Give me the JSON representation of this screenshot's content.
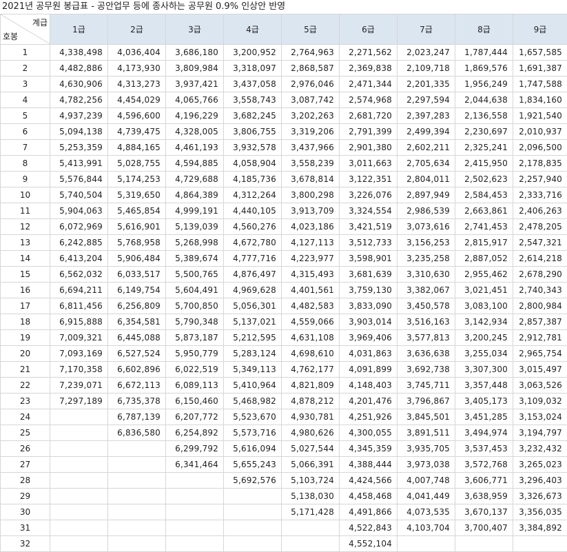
{
  "title": "2021년 공무원 봉급표 - 공안업무 등에 종사하는 공무원 0.9% 인상안 반영",
  "corner": {
    "grade_label": "계급",
    "step_label": "호봉"
  },
  "grades": [
    "1급",
    "2급",
    "3급",
    "4급",
    "5급",
    "6급",
    "7급",
    "8급",
    "9급"
  ],
  "rows": [
    {
      "step": "1",
      "values": [
        "4,338,498",
        "4,036,404",
        "3,686,180",
        "3,200,952",
        "2,764,963",
        "2,271,562",
        "2,023,247",
        "1,787,444",
        "1,657,585"
      ]
    },
    {
      "step": "2",
      "values": [
        "4,482,886",
        "4,173,930",
        "3,809,984",
        "3,318,097",
        "2,868,587",
        "2,369,838",
        "2,109,718",
        "1,869,576",
        "1,691,387"
      ]
    },
    {
      "step": "3",
      "values": [
        "4,630,906",
        "4,313,273",
        "3,937,421",
        "3,437,058",
        "2,976,046",
        "2,471,344",
        "2,201,335",
        "1,956,249",
        "1,747,588"
      ]
    },
    {
      "step": "4",
      "values": [
        "4,782,256",
        "4,454,029",
        "4,065,766",
        "3,558,743",
        "3,087,742",
        "2,574,968",
        "2,297,594",
        "2,044,638",
        "1,834,160"
      ]
    },
    {
      "step": "5",
      "values": [
        "4,937,239",
        "4,596,600",
        "4,196,229",
        "3,682,245",
        "3,202,263",
        "2,681,720",
        "2,397,283",
        "2,136,558",
        "1,921,540"
      ]
    },
    {
      "step": "6",
      "values": [
        "5,094,138",
        "4,739,475",
        "4,328,005",
        "3,806,755",
        "3,319,206",
        "2,791,399",
        "2,499,394",
        "2,230,697",
        "2,010,937"
      ]
    },
    {
      "step": "7",
      "values": [
        "5,253,359",
        "4,884,165",
        "4,461,193",
        "3,932,578",
        "3,437,966",
        "2,901,380",
        "2,602,211",
        "2,325,241",
        "2,096,500"
      ]
    },
    {
      "step": "8",
      "values": [
        "5,413,991",
        "5,028,755",
        "4,594,885",
        "4,058,904",
        "3,558,239",
        "3,011,663",
        "2,705,634",
        "2,415,950",
        "2,178,835"
      ]
    },
    {
      "step": "9",
      "values": [
        "5,576,844",
        "5,174,253",
        "4,729,688",
        "4,185,736",
        "3,678,814",
        "3,122,351",
        "2,804,011",
        "2,502,623",
        "2,257,940"
      ]
    },
    {
      "step": "10",
      "values": [
        "5,740,504",
        "5,319,650",
        "4,864,389",
        "4,312,264",
        "3,800,298",
        "3,226,076",
        "2,897,949",
        "2,584,453",
        "2,333,716"
      ]
    },
    {
      "step": "11",
      "values": [
        "5,904,063",
        "5,465,854",
        "4,999,191",
        "4,440,105",
        "3,913,709",
        "3,324,554",
        "2,986,539",
        "2,663,861",
        "2,406,263"
      ]
    },
    {
      "step": "12",
      "values": [
        "6,072,969",
        "5,616,901",
        "5,139,039",
        "4,560,276",
        "4,023,186",
        "3,421,519",
        "3,073,616",
        "2,741,453",
        "2,478,205"
      ]
    },
    {
      "step": "13",
      "values": [
        "6,242,885",
        "5,768,958",
        "5,268,998",
        "4,672,780",
        "4,127,113",
        "3,512,733",
        "3,156,253",
        "2,815,917",
        "2,547,321"
      ]
    },
    {
      "step": "14",
      "values": [
        "6,413,204",
        "5,906,484",
        "5,389,674",
        "4,777,716",
        "4,223,977",
        "3,598,901",
        "3,235,258",
        "2,887,052",
        "2,614,218"
      ]
    },
    {
      "step": "15",
      "values": [
        "6,562,032",
        "6,033,517",
        "5,500,765",
        "4,876,497",
        "4,315,493",
        "3,681,639",
        "3,310,630",
        "2,955,462",
        "2,678,290"
      ]
    },
    {
      "step": "16",
      "values": [
        "6,694,211",
        "6,149,754",
        "5,604,491",
        "4,969,628",
        "4,401,561",
        "3,759,130",
        "3,382,067",
        "3,021,451",
        "2,740,343"
      ]
    },
    {
      "step": "17",
      "values": [
        "6,811,456",
        "6,256,809",
        "5,700,850",
        "5,056,301",
        "4,482,583",
        "3,833,090",
        "3,450,578",
        "3,083,100",
        "2,800,984"
      ]
    },
    {
      "step": "18",
      "values": [
        "6,915,888",
        "6,354,581",
        "5,790,348",
        "5,137,021",
        "4,559,066",
        "3,903,014",
        "3,516,163",
        "3,142,934",
        "2,857,387"
      ]
    },
    {
      "step": "19",
      "values": [
        "7,009,321",
        "6,445,088",
        "5,873,187",
        "5,212,595",
        "4,631,108",
        "3,969,406",
        "3,577,813",
        "3,200,245",
        "2,912,781"
      ]
    },
    {
      "step": "20",
      "values": [
        "7,093,169",
        "6,527,524",
        "5,950,779",
        "5,283,124",
        "4,698,610",
        "4,031,863",
        "3,636,638",
        "3,255,034",
        "2,965,754"
      ]
    },
    {
      "step": "21",
      "values": [
        "7,170,358",
        "6,602,896",
        "6,022,519",
        "5,349,113",
        "4,762,177",
        "4,091,899",
        "3,692,738",
        "3,307,300",
        "3,015,497"
      ]
    },
    {
      "step": "22",
      "values": [
        "7,239,071",
        "6,672,113",
        "6,089,113",
        "5,410,964",
        "4,821,809",
        "4,148,403",
        "3,745,711",
        "3,357,448",
        "3,063,526"
      ]
    },
    {
      "step": "23",
      "values": [
        "7,297,189",
        "6,735,378",
        "6,150,460",
        "5,468,982",
        "4,878,212",
        "4,201,476",
        "3,796,867",
        "3,405,173",
        "3,109,032"
      ]
    },
    {
      "step": "24",
      "values": [
        "",
        "6,787,139",
        "6,207,772",
        "5,523,670",
        "4,930,781",
        "4,251,926",
        "3,845,501",
        "3,451,285",
        "3,153,024"
      ]
    },
    {
      "step": "25",
      "values": [
        "",
        "6,836,580",
        "6,254,892",
        "5,573,716",
        "4,980,626",
        "4,300,055",
        "3,891,511",
        "3,494,974",
        "3,194,797"
      ]
    },
    {
      "step": "26",
      "values": [
        "",
        "",
        "6,299,792",
        "5,616,094",
        "5,027,544",
        "4,345,359",
        "3,935,705",
        "3,537,453",
        "3,232,432"
      ]
    },
    {
      "step": "27",
      "values": [
        "",
        "",
        "6,341,464",
        "5,655,243",
        "5,066,391",
        "4,388,444",
        "3,973,038",
        "3,572,768",
        "3,265,023"
      ]
    },
    {
      "step": "28",
      "values": [
        "",
        "",
        "",
        "5,692,576",
        "5,103,724",
        "4,424,566",
        "4,007,748",
        "3,606,771",
        "3,296,403"
      ]
    },
    {
      "step": "29",
      "values": [
        "",
        "",
        "",
        "",
        "5,138,030",
        "4,458,468",
        "4,041,449",
        "3,638,959",
        "3,326,673"
      ]
    },
    {
      "step": "30",
      "values": [
        "",
        "",
        "",
        "",
        "5,171,428",
        "4,491,866",
        "4,073,535",
        "3,670,137",
        "3,356,035"
      ]
    },
    {
      "step": "31",
      "values": [
        "",
        "",
        "",
        "",
        "",
        "4,522,843",
        "4,103,704",
        "3,700,407",
        "3,384,892"
      ]
    },
    {
      "step": "32",
      "values": [
        "",
        "",
        "",
        "",
        "",
        "4,552,104",
        "",
        "",
        ""
      ]
    }
  ]
}
